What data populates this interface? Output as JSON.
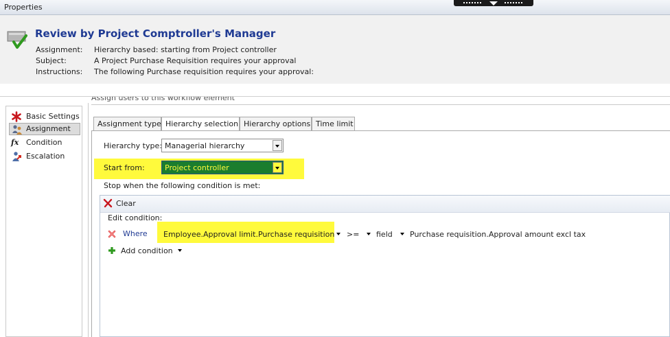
{
  "window": {
    "title": "Properties"
  },
  "header": {
    "title": "Review by Project Comptroller's Manager",
    "fields": [
      {
        "label": "Assignment:",
        "value": "Hierarchy based: starting from Project controller"
      },
      {
        "label": "Subject:",
        "value": "A Project Purchase Requisition requires your approval"
      },
      {
        "label": "Instructions:",
        "value": "The following Purchase requisition requires your approval:"
      }
    ]
  },
  "sidebar": {
    "items": [
      {
        "label": "Basic Settings",
        "icon": "red-asterisk-icon"
      },
      {
        "label": "Assignment",
        "icon": "users-icon",
        "selected": true
      },
      {
        "label": "Condition",
        "icon": "fx-icon"
      },
      {
        "label": "Escalation",
        "icon": "escalation-user-icon"
      }
    ]
  },
  "group": {
    "title": "Assign users to this workflow element"
  },
  "tabs": [
    {
      "label": "Assignment type"
    },
    {
      "label": "Hierarchy selection",
      "active": true
    },
    {
      "label": "Hierarchy options"
    },
    {
      "label": "Time limit"
    }
  ],
  "hierarchy": {
    "type_label": "Hierarchy type:",
    "type_value": "Managerial hierarchy",
    "start_label": "Start from:",
    "start_value": "Project controller",
    "stop_label": "Stop when the following condition is met:"
  },
  "condition": {
    "clear_label": "Clear",
    "edit_label": "Edit condition:",
    "where_label": "Where",
    "field": "Employee.Approval limit.Purchase requisition",
    "operator": ">=",
    "value_type": "field",
    "value": "Purchase requisition.Approval amount excl tax",
    "add_label": "Add condition"
  },
  "colors": {
    "highlight": "#fffa3c",
    "selected_combo": "#1b7d2e",
    "title_blue": "#1f3a93"
  }
}
